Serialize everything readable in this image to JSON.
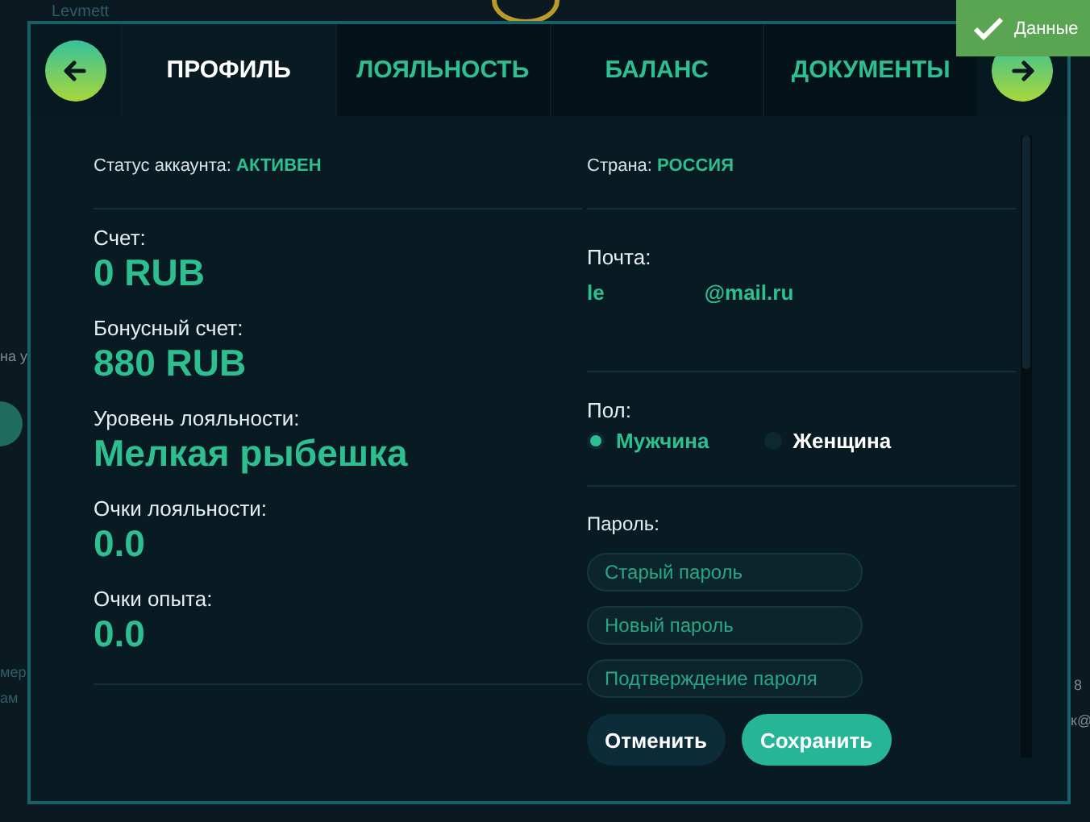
{
  "backdrop": {
    "texts": [
      "Levmett",
      "на у",
      "мер",
      "ам",
      "8",
      "к@"
    ]
  },
  "toast": {
    "text": "Данные"
  },
  "tabs": [
    {
      "label": "ПРОФИЛЬ",
      "selected": true
    },
    {
      "label": "ЛОЯЛЬНОСТЬ",
      "selected": false
    },
    {
      "label": "БАЛАНС",
      "selected": false
    },
    {
      "label": "ДОКУМЕНТЫ",
      "selected": false
    }
  ],
  "left": {
    "status": {
      "label": "Статус аккаунта:",
      "value": "АКТИВЕН"
    },
    "stats": [
      {
        "label": "Счет:",
        "value": "0 RUB"
      },
      {
        "label": "Бонусный счет:",
        "value": "880 RUB"
      },
      {
        "label": "Уровень лояльности:",
        "value": "Мелкая рыбешка"
      },
      {
        "label": "Очки лояльности:",
        "value": "0.0"
      },
      {
        "label": "Очки опыта:",
        "value": "0.0"
      }
    ]
  },
  "right": {
    "country": {
      "label": "Страна:",
      "value": "РОССИЯ"
    },
    "email": {
      "label": "Почта:",
      "value_start": "le",
      "value_end": "@mail.ru"
    },
    "gender": {
      "label": "Пол:",
      "options": [
        {
          "label": "Мужчина",
          "selected": true
        },
        {
          "label": "Женщина",
          "selected": false
        }
      ]
    },
    "password": {
      "label": "Пароль:",
      "fields": [
        {
          "placeholder": "Старый пароль"
        },
        {
          "placeholder": "Новый пароль"
        },
        {
          "placeholder": "Подтверждение пароля"
        }
      ]
    },
    "buttons": [
      {
        "label": "Отменить",
        "kind": "secondary"
      },
      {
        "label": "Сохранить",
        "kind": "primary"
      }
    ]
  }
}
